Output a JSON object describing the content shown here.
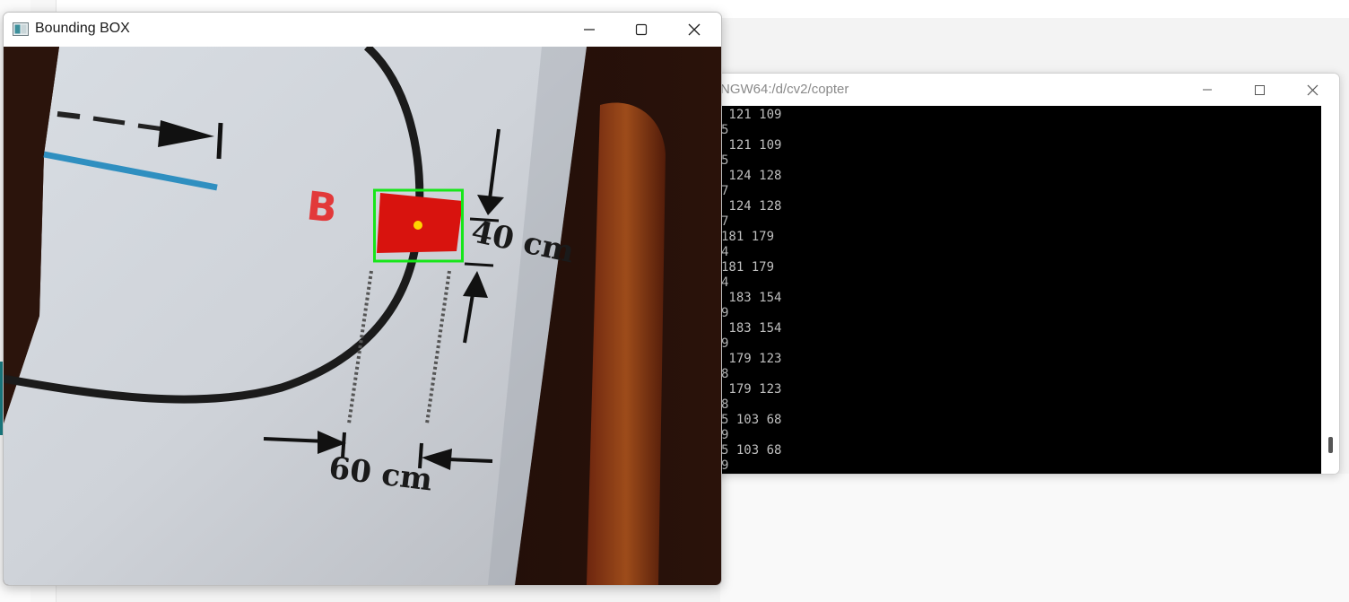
{
  "opencv_window": {
    "title": "Bounding BOX",
    "image_labels": {
      "letter": "B",
      "dim_vertical": "40 cm",
      "dim_horizontal": "60 cm"
    },
    "colors": {
      "bbox": "#17e61a",
      "target": "#d8130e",
      "center_dot": "#ffd400"
    }
  },
  "terminal_window": {
    "title": "NGW64:/d/cv2/copter",
    "lines": [
      " 121 109",
      "5",
      " 121 109",
      "5",
      " 124 128",
      "7",
      " 124 128",
      "7",
      "181 179",
      "4",
      "181 179",
      "4",
      " 183 154",
      "9",
      " 183 154",
      "9",
      " 179 123",
      "8",
      " 179 123",
      "8",
      "5 103 68",
      "9",
      "5 103 68",
      "9"
    ]
  }
}
